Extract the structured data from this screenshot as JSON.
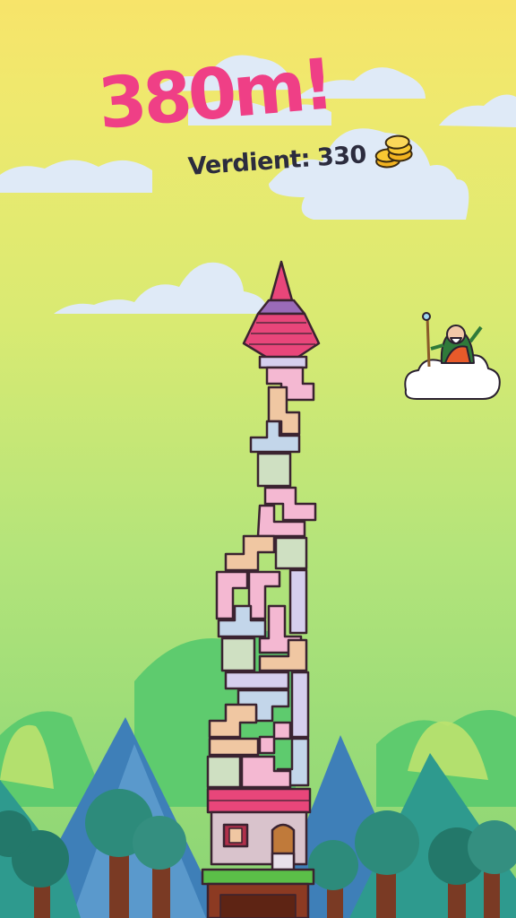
{
  "hud": {
    "height_reached": "380m!",
    "earned_label": "Verdient:",
    "earned_value": "330",
    "coin_icon": "coin-stack-icon"
  },
  "characters": {
    "wizard_icon": "wizard-on-cloud-icon"
  },
  "colors": {
    "score_pink": "#ef3f86",
    "text_dark": "#2c2c3e",
    "roof_pink": "#e8467a",
    "block_pink": "#f4b8d2",
    "block_peach": "#f0c7a2",
    "block_mint": "#cfe0c2",
    "block_lavender": "#d6cfee",
    "block_blue": "#c3d6ea"
  }
}
